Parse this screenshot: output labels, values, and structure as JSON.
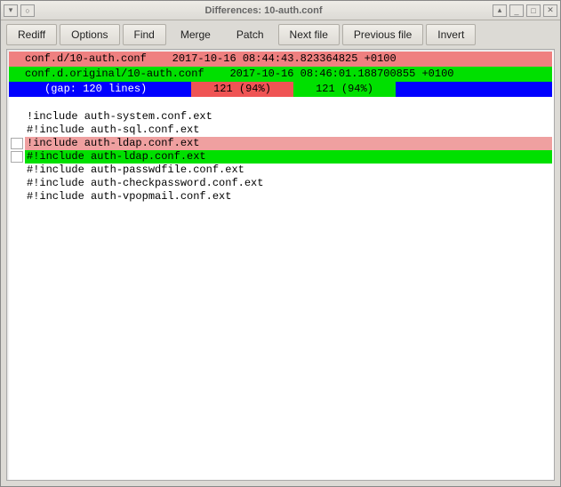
{
  "window": {
    "title": "Differences: 10-auth.conf",
    "tb_left": {
      "menu": "▾",
      "pin": "○"
    },
    "tb_right": {
      "roll": "▴",
      "min": "_",
      "max": "□",
      "close": "✕"
    }
  },
  "toolbar": {
    "rediff": "Rediff",
    "options": "Options",
    "find": "Find",
    "merge": "Merge",
    "patch": "Patch",
    "next": "Next file",
    "prev": "Previous file",
    "invert": "Invert"
  },
  "diff": {
    "header_old": "conf.d/10-auth.conf    2017-10-16 08:44:43.823364825 +0100",
    "header_new": "conf.d.original/10-auth.conf    2017-10-16 08:46:01.188700855 +0100",
    "gap_label": "(gap: 120 lines)",
    "gap_left_count": "121 (94%)",
    "gap_right_count": "121 (94%)",
    "context_before": [
      "!include auth-system.conf.ext",
      "#!include auth-sql.conf.ext"
    ],
    "removed": "!include auth-ldap.conf.ext",
    "added": "#!include auth-ldap.conf.ext",
    "context_after": [
      "#!include auth-passwdfile.conf.ext",
      "#!include auth-checkpassword.conf.ext",
      "#!include auth-vpopmail.conf.ext"
    ]
  }
}
